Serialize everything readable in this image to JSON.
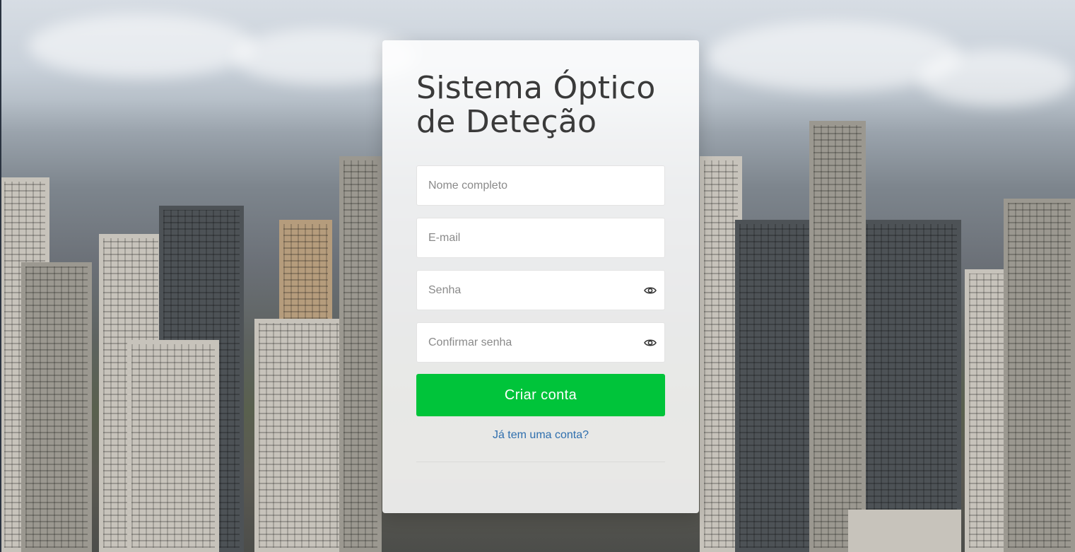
{
  "form": {
    "title": "Sistema Óptico de Deteção",
    "fields": {
      "full_name_placeholder": "Nome completo",
      "email_placeholder": "E-mail",
      "password_placeholder": "Senha",
      "confirm_password_placeholder": "Confirmar senha"
    },
    "icons": {
      "password_toggle": "eye-icon",
      "confirm_password_toggle": "eye-icon"
    },
    "submit_label": "Criar conta",
    "login_link": "Já tem uma conta?"
  },
  "colors": {
    "primary_button": "#00c43a",
    "link": "#2f6fae",
    "title_text": "#3a3a3a"
  }
}
